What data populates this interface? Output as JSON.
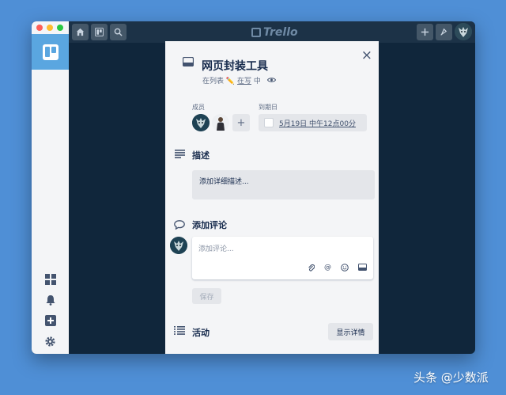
{
  "app": {
    "brand": "Trello",
    "sidebar_icons": [
      "boards-grid-icon",
      "bell-icon",
      "plus-square-icon",
      "gear-icon"
    ]
  },
  "card": {
    "title": "网页封装工具",
    "list_prefix": "在列表",
    "list_name": "在写",
    "list_suffix": "中",
    "close_icon": "×",
    "members_label": "成员",
    "due_label": "到期日",
    "due_value": "5月19日 中午12点00分",
    "description_title": "描述",
    "description_placeholder": "添加详细描述...",
    "comment_title": "添加评论",
    "comment_placeholder": "添加评论...",
    "save_label": "保存",
    "activity_title": "活动",
    "show_details_label": "显示详情"
  },
  "watermark": "头条 @少数派",
  "colors": {
    "desktop": "#4f8fd6",
    "board_bg": "#10263b",
    "sidebar_accent": "#5aa6e0",
    "modal_bg": "#f4f5f7"
  }
}
